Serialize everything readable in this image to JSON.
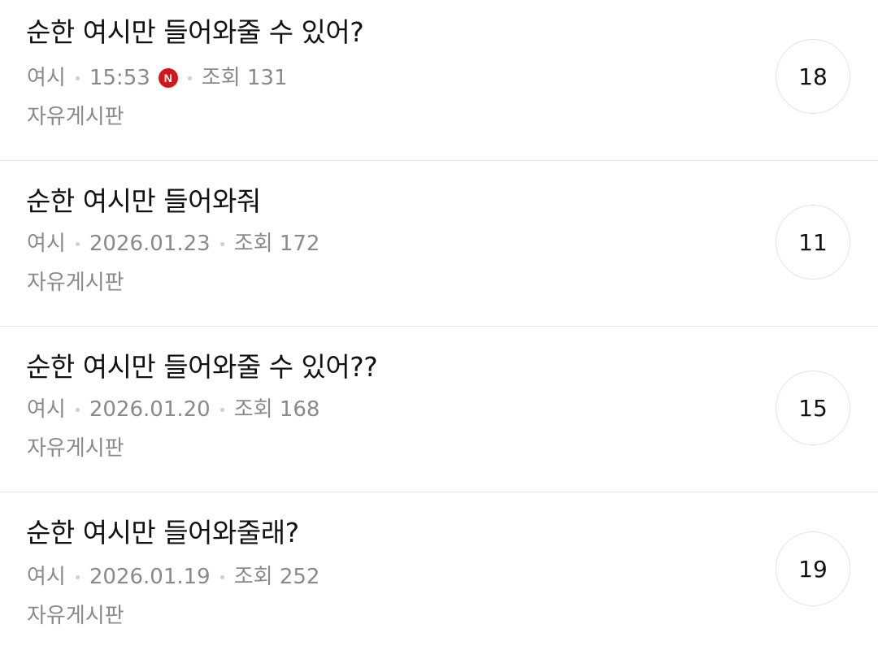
{
  "posts": [
    {
      "title": "순한 여시만 들어와줄 수 있어?",
      "author": "여시",
      "time": "15:53",
      "new_badge": "N",
      "views": "조회 131",
      "board": "자유게시판",
      "comments": "18"
    },
    {
      "title": "순한 여시만 들어와줘",
      "author": "여시",
      "time": "2026.01.23",
      "views": "조회 172",
      "board": "자유게시판",
      "comments": "11"
    },
    {
      "title": "순한 여시만 들어와줄 수 있어??",
      "author": "여시",
      "time": "2026.01.20",
      "views": "조회 168",
      "board": "자유게시판",
      "comments": "15"
    },
    {
      "title": "순한 여시만 들어와줄래?",
      "author": "여시",
      "time": "2026.01.19",
      "views": "조회 252",
      "board": "자유게시판",
      "comments": "19"
    }
  ],
  "colors": {
    "title": "#111111",
    "meta": "#8a8a8a",
    "new_badge": "#d6151b",
    "divider": "#e6e6e6"
  }
}
